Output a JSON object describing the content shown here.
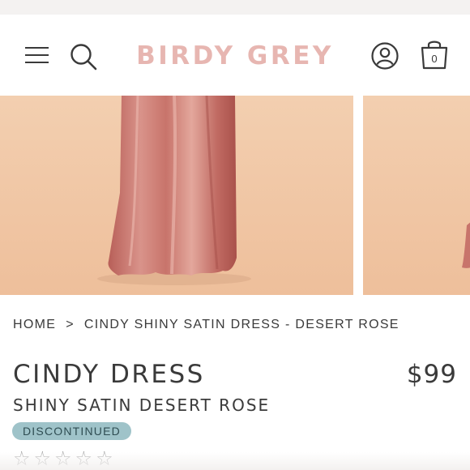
{
  "header": {
    "brand": "BIRDY GREY",
    "cart_count": "0",
    "icons": [
      "menu-icon",
      "search-icon",
      "account-icon",
      "shopping-bag-icon"
    ]
  },
  "gallery": {
    "images": [
      "dress-photo",
      "dress-photo"
    ],
    "colors": {
      "background": "#f1c9a8",
      "dress": "#c9776d"
    }
  },
  "breadcrumb": {
    "home": "HOME",
    "separator": ">",
    "current": "CINDY SHINY SATIN DRESS - DESERT ROSE"
  },
  "product": {
    "title": "CINDY DRESS",
    "price": "$99",
    "subtitle": "SHINY SATIN DESERT ROSE",
    "status": "DISCONTINUED",
    "rating_icons": [
      "star-icon",
      "star-icon",
      "star-icon",
      "star-icon",
      "star-icon"
    ]
  },
  "colors": {
    "brand": "#e7b6b1",
    "badge": "#9fc3c9",
    "text": "#3a3a3a"
  }
}
